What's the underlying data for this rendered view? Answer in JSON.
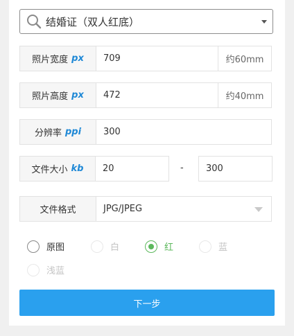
{
  "doc_select": {
    "value": "结婚证（双人红底）"
  },
  "width_row": {
    "label": "照片宽度",
    "unit": "px",
    "value": "709",
    "suffix": "约60mm"
  },
  "height_row": {
    "label": "照片高度",
    "unit": "px",
    "value": "472",
    "suffix": "约40mm"
  },
  "dpi_row": {
    "label": "分辨率",
    "unit": "ppi",
    "value": "300"
  },
  "size_row": {
    "label": "文件大小",
    "unit": "kb",
    "min": "20",
    "separator": "-",
    "max": "300"
  },
  "format_row": {
    "label": "文件格式",
    "value": "JPG/JPEG"
  },
  "bg_options": [
    {
      "label": "原图",
      "state": "normal"
    },
    {
      "label": "白",
      "state": "disabled"
    },
    {
      "label": "红",
      "state": "selected"
    },
    {
      "label": "蓝",
      "state": "disabled"
    },
    {
      "label": "浅蓝",
      "state": "disabled"
    }
  ],
  "next_button": {
    "label": "下一步"
  },
  "colors": {
    "accent": "#2aa0ee",
    "unit": "#1e88d6",
    "selected": "#5cb85c"
  }
}
